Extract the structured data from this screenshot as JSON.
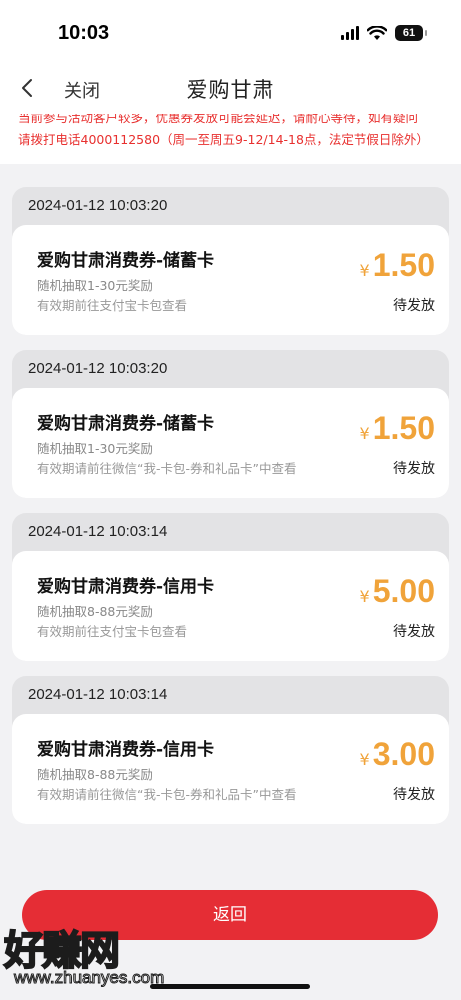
{
  "status_bar": {
    "time": "10:03",
    "battery": "61"
  },
  "nav": {
    "close_label": "关闭",
    "title": "爱购甘肃"
  },
  "notice": {
    "line1": "当前参与活动客户较多，优惠券发放可能会延迟，请耐心等待，如有疑问",
    "line2": "请拨打电话4000112580（周一至周五9-12/14-18点，法定节假日除外）"
  },
  "records": [
    {
      "date": "2024-01-12 10:03:20",
      "title": "爱购甘肃消费券-储蓄卡",
      "subtitle": "随机抽取1-30元奖励",
      "note": "有效期前往支付宝卡包查看",
      "currency": "¥",
      "amount": "1.50",
      "status": "待发放"
    },
    {
      "date": "2024-01-12 10:03:20",
      "title": "爱购甘肃消费券-储蓄卡",
      "subtitle": "随机抽取1-30元奖励",
      "note": "有效期请前往微信“我-卡包-券和礼品卡”中查看",
      "currency": "¥",
      "amount": "1.50",
      "status": "待发放"
    },
    {
      "date": "2024-01-12 10:03:14",
      "title": "爱购甘肃消费券-信用卡",
      "subtitle": "随机抽取8-88元奖励",
      "note": "有效期前往支付宝卡包查看",
      "currency": "¥",
      "amount": "5.00",
      "status": "待发放"
    },
    {
      "date": "2024-01-12 10:03:14",
      "title": "爱购甘肃消费券-信用卡",
      "subtitle": "随机抽取8-88元奖励",
      "note": "有效期请前往微信“我-卡包-券和礼品卡”中查看",
      "currency": "¥",
      "amount": "3.00",
      "status": "待发放"
    }
  ],
  "footer": {
    "return_label": "返回"
  },
  "watermark": {
    "brand": "好赚网",
    "url": "www.zhuanyes.com"
  },
  "colors": {
    "accent_red": "#e52d35",
    "notice_red": "#e8302f",
    "amount_orange": "#f0a33a"
  },
  "icons": {
    "back": "chevron-left-icon",
    "signal": "signal-icon",
    "wifi": "wifi-icon",
    "battery": "battery-icon"
  }
}
